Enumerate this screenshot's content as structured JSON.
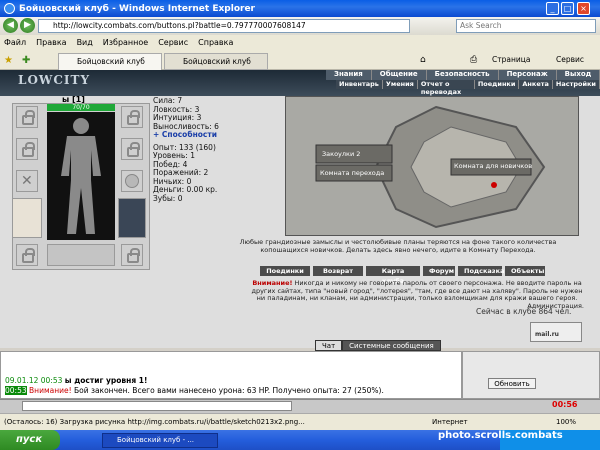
{
  "window": {
    "title": "Бойцовский клуб - Windows Internet Explorer"
  },
  "address": {
    "url": "http://lowcity.combats.com/buttons.pl?battle=0.797770007608147",
    "search_placeholder": "Ask Search"
  },
  "menubar": [
    "Файл",
    "Правка",
    "Вид",
    "Избранное",
    "Сервис",
    "Справка"
  ],
  "tabs": [
    {
      "label": "Бойцовский клуб"
    },
    {
      "label": "Бойцовский клуб"
    }
  ],
  "toolbar": {
    "page": "Страница",
    "service": "Сервис"
  },
  "game": {
    "logo": "LOWCITY",
    "topmenu": [
      "Знания",
      "Общение",
      "Безопасность",
      "Персонаж",
      "Выход"
    ],
    "submenu": [
      "Инвентарь",
      "Умения",
      "Отчет о переводах",
      "Поединки",
      "Анкета",
      "Настройки"
    ]
  },
  "character": {
    "name": "ы [1]",
    "hp": "70/70",
    "stats": [
      "Сила: 7",
      "Ловкость: 3",
      "Интуиция: 3",
      "Выносливость: 6"
    ],
    "abilities": "+ Способности",
    "exp": "Опыт: 133 (160)",
    "level": "Уровень: 1",
    "wins": "Побед: 4",
    "losses": "Поражений: 2",
    "draws": "Ничьих: 0",
    "money": "Деньги: 0.00 кр.",
    "teeth": "Зубы: 0"
  },
  "map": {
    "left_label": "Закоулки 2",
    "left_label2": "Комната перехода",
    "right_label": "Комната для новичков"
  },
  "map_description": "Любые грандиозные замыслы и честолюбивые планы теряются на фоне такого количества копошащихся новичков. Делать здесь явно нечего, идите в Комнату Перехода.",
  "buttons": [
    "Поединки",
    "Возврат",
    "Карта клуба",
    "Форум",
    "Подсказка",
    "Объекты"
  ],
  "warning": {
    "title": "Внимание!",
    "text": "Никогда и никому не говорите пароль от своего персонажа. Не вводите пароль на других сайтах, типа \"новый город\", \"лотерея\", \"там, где все дают на халяву\". Пароль не нужен ни паладинам, ни кланам, ни администрации, только взломщикам для кражи вашего героя.",
    "sign": "Администрация."
  },
  "online": "Сейчас в клубе 864 чел.",
  "counter": "mail.ru",
  "chat": {
    "tabs": [
      "Чат",
      "Системные сообщения"
    ],
    "lines": [
      {
        "time": "09.01.12 00:53",
        "text": "ы достиг уровня 1!"
      },
      {
        "time": "00:53",
        "label": "Внимание!",
        "text": "Бой закончен. Всего вами нанесено урона: 63 HP. Получено опыта: 27 (250%)."
      }
    ],
    "refresh": "Обновить",
    "clock": "00:56"
  },
  "status": {
    "text": "(Осталось: 16) Загрузка рисунка http://img.combats.ru/i/battle/sketch0213x2.png...",
    "zone": "Интернет",
    "zoom": "100%"
  },
  "taskbar": {
    "start": "пуск",
    "item": "Бойцовский клуб - ...",
    "watermark": "photo.scrolls.combats"
  }
}
